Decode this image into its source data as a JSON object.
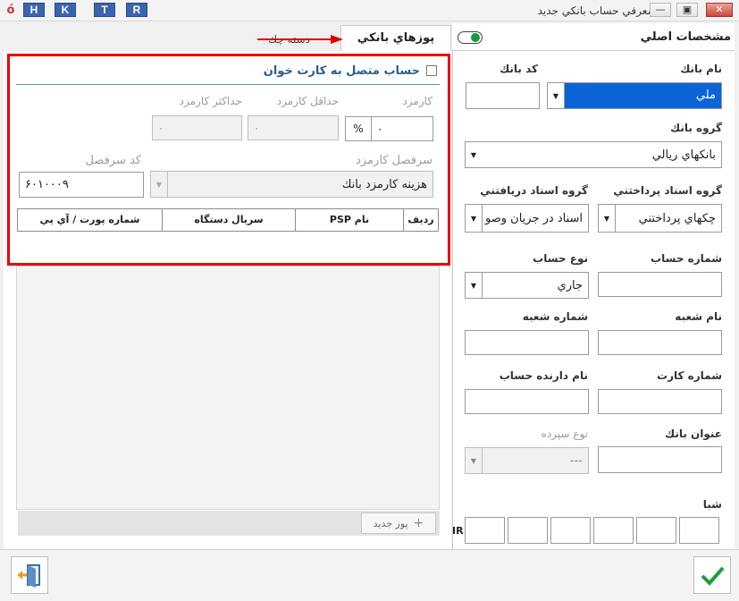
{
  "titlebar": {
    "title": "معرفي حساب بانكي جديد",
    "hotkeys": [
      "H",
      "K",
      "T",
      "R"
    ],
    "app_logo": "ó"
  },
  "tabs": {
    "general": "مشخصات اصلي",
    "pos": "پوزهاي بانكي",
    "checkbook": "دسته چك"
  },
  "form": {
    "bank_name_label": "نام بانك",
    "bank_name_value": "ملي",
    "bank_code_label": "كد بانك",
    "bank_code_value": "",
    "bank_group_label": "گروه بانك",
    "bank_group_value": "بانكهاي ريالي",
    "pay_doc_group_label": "گروه اسناد پرداختني",
    "pay_doc_group_value": "چكهاي پرداختني",
    "recv_doc_group_label": "گروه اسناد دريافتني",
    "recv_doc_group_value": "اسناد در جريان وصو",
    "account_no_label": "شماره حساب",
    "account_type_label": "نوع حساب",
    "account_type_value": "جاري",
    "branch_name_label": "نام شعبه",
    "branch_no_label": "شماره شعبه",
    "card_no_label": "شماره كارت",
    "holder_name_label": "نام دارنده حساب",
    "bank_title_label": "عنوان بانك",
    "deposit_type_label": "نوع سپرده",
    "deposit_type_value": "---",
    "sheba_label": "شبا",
    "iban_prefix": "IR"
  },
  "pos_panel": {
    "card_reader_label": "حساب متصل به كارت خوان",
    "fee_label": "كارمزد",
    "fee_value": "۰",
    "fee_unit": "%",
    "min_fee_label": "حداقل كارمزد",
    "min_fee_value": "۰",
    "max_fee_label": "حداكثر كارمزد",
    "max_fee_value": "۰",
    "fee_ledger_label": "سرفصل كارمزد",
    "fee_ledger_value": "هزينه كارمزد بانك",
    "ledger_code_label": "كد سرفصل",
    "ledger_code_value": "۶۰۱۰۰۰۹",
    "grid_headers": [
      "رديف",
      "نام PSP",
      "سريال دستگاه",
      "شماره پورت / آي پي"
    ],
    "new_pos_button": "پوز جديد"
  },
  "colors": {
    "accent": "#0a64d6",
    "highlight_box": "#e00000",
    "confirm": "#1aa03c"
  }
}
